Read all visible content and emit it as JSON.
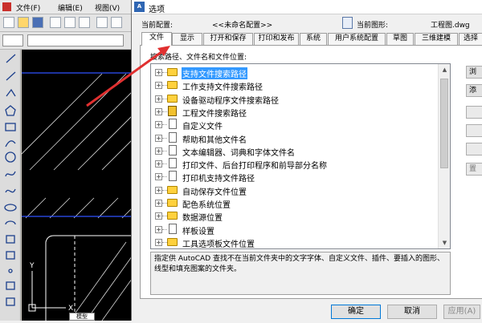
{
  "acad": {
    "menu": [
      "文件(F)",
      "编辑(E)",
      "视图(V)"
    ],
    "model_tab": "模型"
  },
  "dialog": {
    "title": "选项",
    "current_profile_label": "当前配置:",
    "current_profile_value": "<<未命名配置>>",
    "current_drawing_label": "当前图形:",
    "current_drawing_value": "工程图.dwg",
    "tabs": [
      "文件",
      "显示",
      "打开和保存",
      "打印和发布",
      "系统",
      "用户系统配置",
      "草图",
      "三维建模",
      "选择"
    ],
    "active_tab": "文件",
    "tree_heading": "搜索路径、文件名和文件位置:",
    "tree_items": [
      {
        "label": "支持文件搜索路径",
        "icon": "folder-icon",
        "selected": true
      },
      {
        "label": "工作支持文件搜索路径",
        "icon": "folder-icon",
        "selected": false
      },
      {
        "label": "设备驱动程序文件搜索路径",
        "icon": "folder-icon",
        "selected": false
      },
      {
        "label": "工程文件搜索路径",
        "icon": "book-icon",
        "selected": false
      },
      {
        "label": "自定义文件",
        "icon": "document-icon",
        "selected": false
      },
      {
        "label": "帮助和其他文件名",
        "icon": "document-icon",
        "selected": false
      },
      {
        "label": "文本编辑器、词典和字体文件名",
        "icon": "document-icon",
        "selected": false
      },
      {
        "label": "打印文件、后台打印程序和前导部分名称",
        "icon": "document-icon",
        "selected": false
      },
      {
        "label": "打印机支持文件路径",
        "icon": "document-icon",
        "selected": false
      },
      {
        "label": "自动保存文件位置",
        "icon": "folder-icon",
        "selected": false
      },
      {
        "label": "配色系统位置",
        "icon": "folder-icon",
        "selected": false
      },
      {
        "label": "数据源位置",
        "icon": "folder-icon",
        "selected": false
      },
      {
        "label": "样板设置",
        "icon": "document-icon",
        "selected": false
      },
      {
        "label": "工具选项板文件位置",
        "icon": "folder-icon",
        "selected": false
      }
    ],
    "side_buttons": [
      "浏",
      "添",
      "",
      "",
      "",
      "置"
    ],
    "description": "指定供 AutoCAD 查找不在当前文件夹中的文字字体、自定义文件、插件、要插入的图形、线型和填充图案的文件夹。",
    "buttons": {
      "ok": "确定",
      "cancel": "取消",
      "apply": "应用(A)"
    },
    "colors": {
      "selection": "#3399ff",
      "default_button_border": "#0078d7",
      "annotation_arrow": "#e03030"
    }
  }
}
